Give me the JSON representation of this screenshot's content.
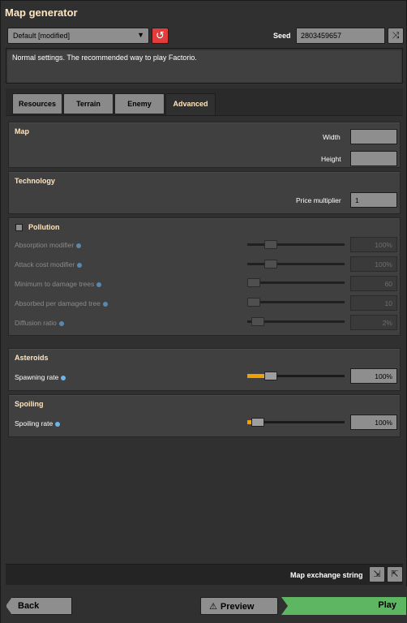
{
  "window": {
    "title": "Map generator"
  },
  "preset": {
    "selected": "Default [modified]",
    "caret": "▼",
    "reset_icon": "↺"
  },
  "seed": {
    "label": "Seed",
    "value": "2803459657",
    "shuffle_icon": "⤨"
  },
  "description": "Normal settings. The recommended way to play Factorio.",
  "tabs": [
    {
      "label": "Resources",
      "active": false
    },
    {
      "label": "Terrain",
      "active": false
    },
    {
      "label": "Enemy",
      "active": false
    },
    {
      "label": "Advanced",
      "active": true
    }
  ],
  "map": {
    "title": "Map",
    "width": {
      "label": "Width",
      "value": ""
    },
    "height": {
      "label": "Height",
      "value": ""
    }
  },
  "technology": {
    "title": "Technology",
    "price_multiplier": {
      "label": "Price multiplier",
      "value": "1"
    }
  },
  "pollution": {
    "title": "Pollution",
    "enabled": false,
    "rows": [
      {
        "label": "Absorption modifier",
        "value": "100%",
        "level": 0.2
      },
      {
        "label": "Attack cost modifier",
        "value": "100%",
        "level": 0.2
      },
      {
        "label": "Minimum to damage trees",
        "value": "60",
        "level": 0.0
      },
      {
        "label": "Absorbed per damaged tree",
        "value": "10",
        "level": 0.0
      },
      {
        "label": "Diffusion ratio",
        "value": "2%",
        "level": 0.05
      }
    ]
  },
  "asteroids": {
    "title": "Asteroids",
    "spawning_rate": {
      "label": "Spawning rate",
      "value": "100%",
      "level": 0.2
    }
  },
  "spoiling": {
    "title": "Spoiling",
    "spoiling_rate": {
      "label": "Spoiling rate",
      "value": "100%",
      "level": 0.05
    }
  },
  "map_exchange": {
    "label": "Map exchange string",
    "import_icon": "⇲",
    "export_icon": "⇱"
  },
  "footer": {
    "back": "Back",
    "preview": "Preview",
    "preview_icon": "⚠",
    "play": "Play"
  },
  "colors": {
    "accent": "#ffe6c0",
    "slider_fill": "#f0a000",
    "play": "#5eb663",
    "reset": "#e23c3c"
  }
}
